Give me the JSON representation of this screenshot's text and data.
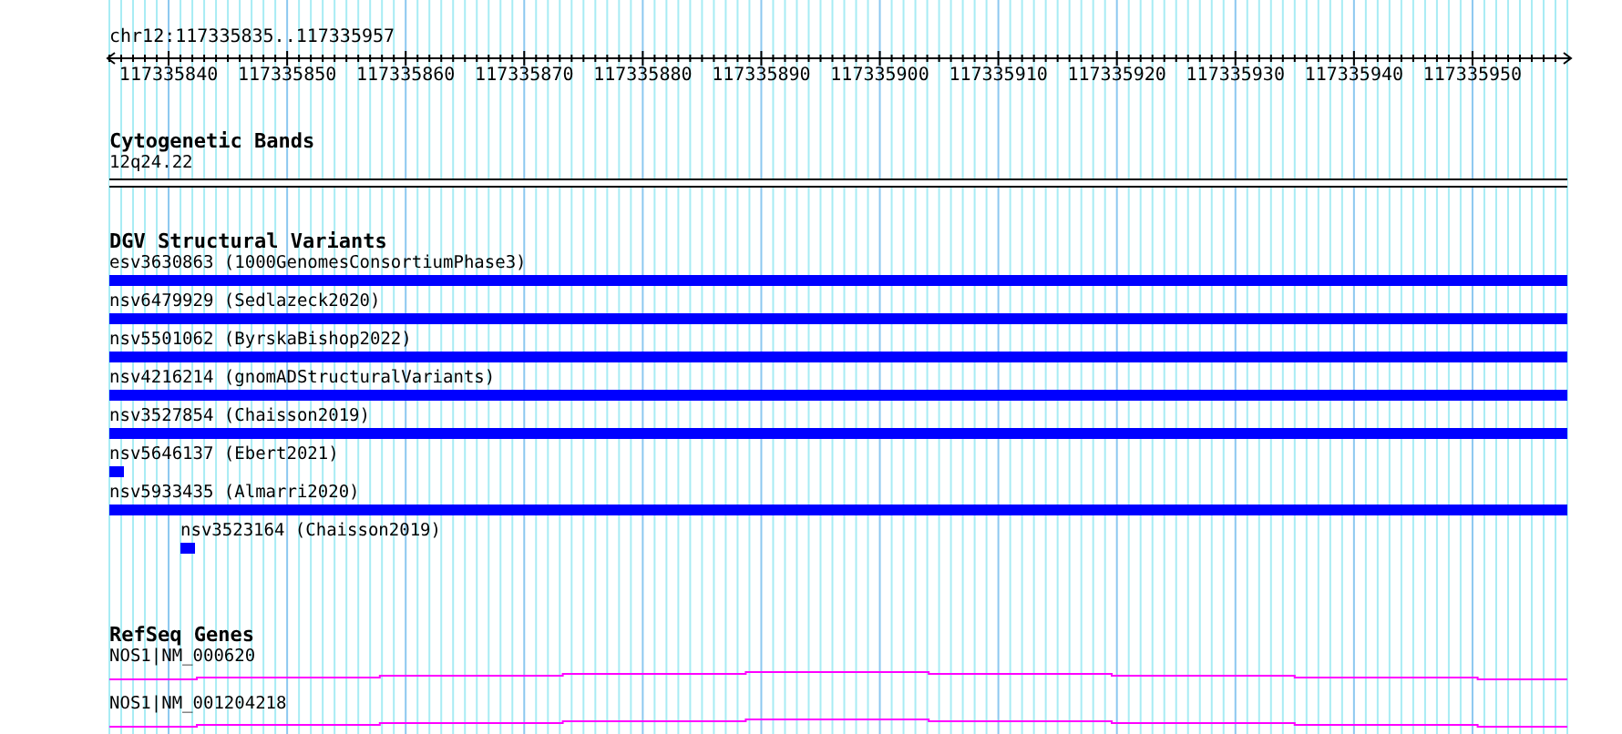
{
  "ruler": {
    "region": "chr12:117335835..117335957",
    "ticks": [
      "117335840",
      "117335850",
      "117335860",
      "117335870",
      "117335880",
      "117335890",
      "117335900",
      "117335910",
      "117335920",
      "117335930",
      "117335940",
      "117335950"
    ]
  },
  "cytoband_track": {
    "title": "Cytogenetic Bands",
    "band": "12q24.22"
  },
  "dgv_track": {
    "title": "DGV Structural Variants",
    "variants": [
      {
        "label": "esv3630863 (1000GenomesConsortiumPhase3)",
        "kind": "spanning"
      },
      {
        "label": "nsv6479929 (Sedlazeck2020)",
        "kind": "spanning"
      },
      {
        "label": "nsv5501062 (ByrskaBishop2022)",
        "kind": "spanning"
      },
      {
        "label": "nsv4216214 (gnomADStructuralVariants)",
        "kind": "spanning"
      },
      {
        "label": "nsv3527854 (Chaisson2019)",
        "kind": "spanning"
      },
      {
        "label": "nsv5646137 (Ebert2021)",
        "kind": "point"
      },
      {
        "label": "nsv5933435 (Almarri2020)",
        "kind": "spanning"
      },
      {
        "label": "nsv3523164 (Chaisson2019)",
        "kind": "shifted-point"
      }
    ]
  },
  "refseq_track": {
    "title": "RefSeq Genes",
    "genes": [
      {
        "label": "NOS1|NM_000620"
      },
      {
        "label": "NOS1|NM_001204218"
      }
    ]
  }
}
